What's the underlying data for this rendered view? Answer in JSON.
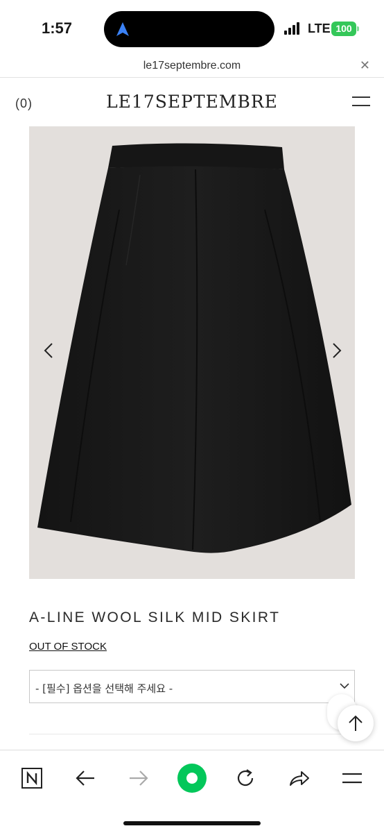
{
  "status_bar": {
    "time": "1:57",
    "network": "LTE",
    "battery": "100",
    "battery_color": "#34c759"
  },
  "browser": {
    "url": "le17septembre.com",
    "close_icon": "close-icon"
  },
  "header": {
    "cart_count": "(0)",
    "logo": "LE17SEPTEMBRE",
    "menu_icon": "hamburger-icon"
  },
  "product": {
    "image_description_icon": "skirt-image",
    "prev_icon": "chevron-left-icon",
    "next_icon": "chevron-right-icon",
    "title": "A-LINE WOOL SILK MID SKIRT",
    "stock_status": "OUT OF STOCK",
    "option_placeholder": "- [필수] 옵션을 선택해 주세요 -"
  },
  "toolbar": {
    "items": [
      "naver-home-icon",
      "back-icon",
      "forward-icon",
      "green-dot-icon",
      "reload-icon",
      "share-icon",
      "menu-icon"
    ],
    "accent_color": "#03c75a"
  }
}
